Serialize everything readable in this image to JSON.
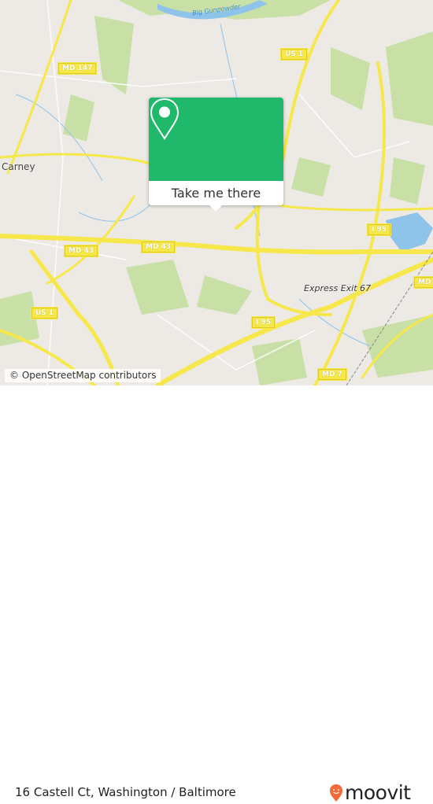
{
  "map": {
    "labels": {
      "river": "Big Gunpowder",
      "md147": "MD 147",
      "us1_top": "US 1",
      "carney": "Carney",
      "md43_left": "MD 43",
      "md43_mid": "MD 43",
      "i95_right": "I 95",
      "express_exit": "Express Exit 67",
      "us1_bottom": "US 1",
      "i95_bottom": "I 95",
      "md7": "MD 7",
      "md_edge": "MD"
    },
    "attribution": "© OpenStreetMap contributors",
    "colors": {
      "land": "#ede9e4",
      "park": "#c4dfa0",
      "road": "#f6e84a",
      "water": "#8ec3ea",
      "accent": "#20b86b"
    }
  },
  "popup": {
    "icon": "map-pin-icon",
    "button_label": "Take me there"
  },
  "footer": {
    "address": "16 Castell Ct, Washington / Baltimore",
    "brand": "moovit",
    "brand_color": "#f26b38"
  }
}
